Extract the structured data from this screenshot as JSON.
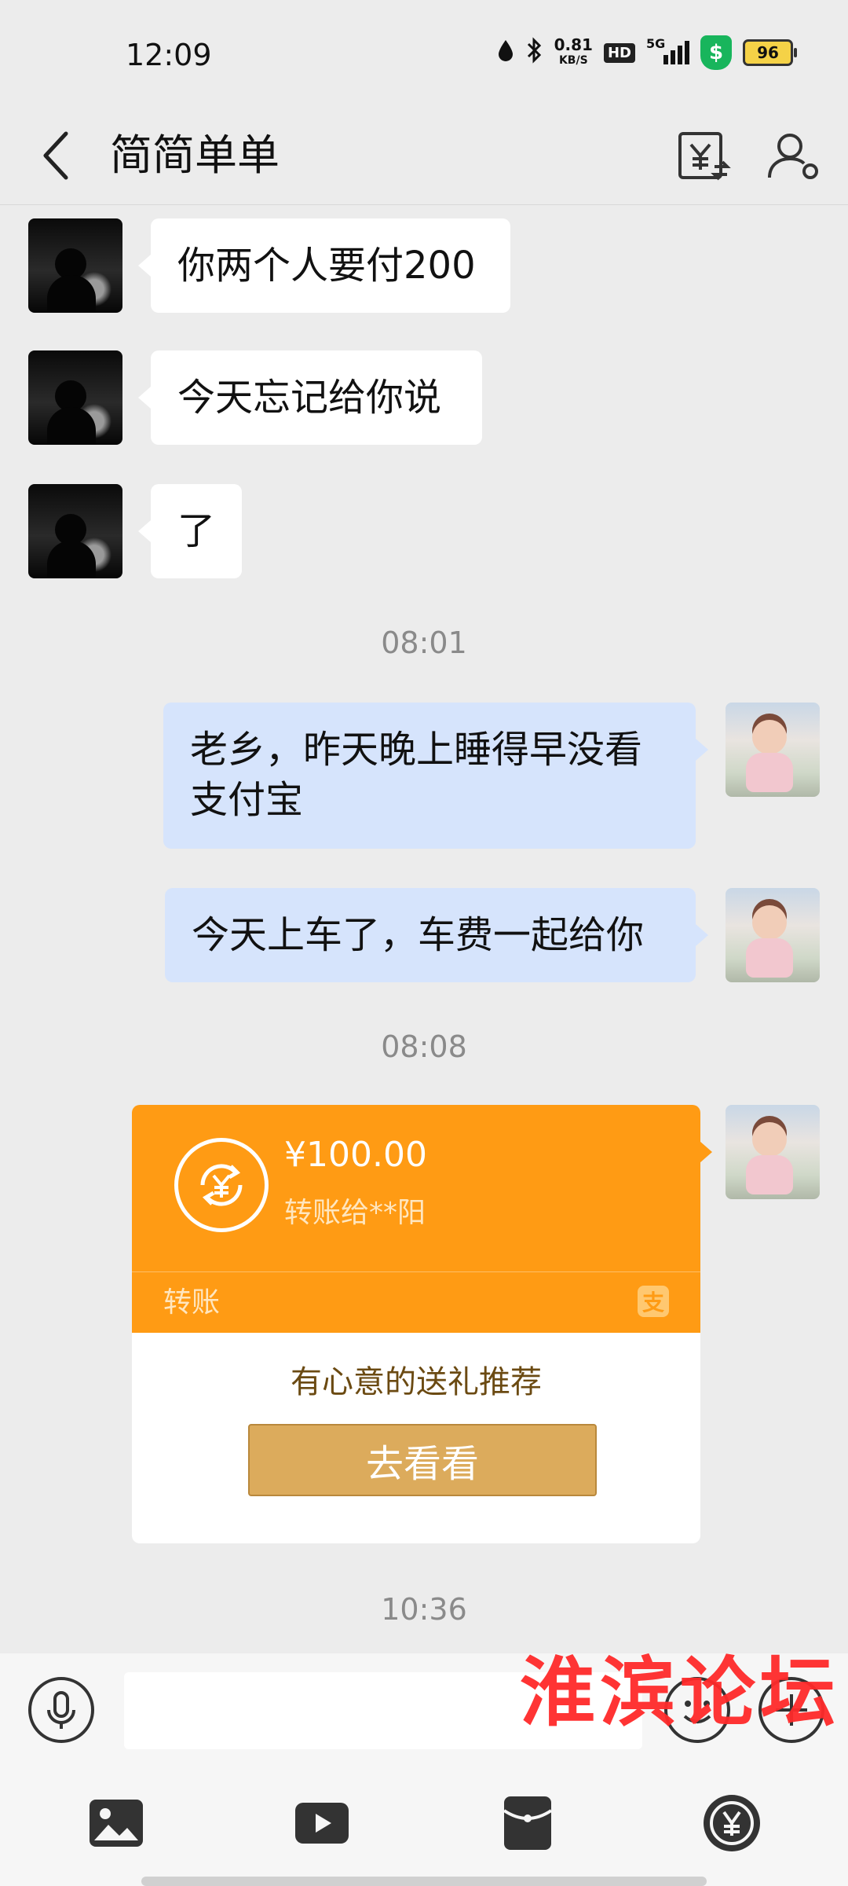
{
  "status_bar": {
    "time": "12:09",
    "net_speed": "0.81",
    "net_unit": "KB/S",
    "hd": "HD",
    "network": "5G",
    "battery": "96"
  },
  "header": {
    "title": "简简单单"
  },
  "messages": [
    {
      "side": "left",
      "text": "你两个人要付200"
    },
    {
      "side": "left",
      "text": "今天忘记给你说"
    },
    {
      "side": "left",
      "text": "了"
    },
    {
      "side": "right",
      "text": "老乡，昨天晚上睡得早没看支付宝"
    },
    {
      "side": "right",
      "text": "今天上车了，车费一起给你"
    }
  ],
  "timestamps": [
    "08:01",
    "08:08",
    "10:36"
  ],
  "transfer_card": {
    "amount": "¥100.00",
    "recipient": "转账给**阳",
    "label": "转账",
    "badge": "支",
    "promo_text": "有心意的送礼推荐",
    "button_label": "去看看"
  },
  "watermark": "淮滨论坛",
  "icons": {
    "back": "back-arrow-icon",
    "header_transfer": "yen-transfer-icon",
    "header_profile": "user-settings-icon",
    "mic": "microphone-icon",
    "emoji": "emoji-icon",
    "plus": "plus-icon",
    "toolbar": [
      "image-icon",
      "video-icon",
      "red-packet-icon",
      "transfer-icon"
    ]
  },
  "colors": {
    "accent_orange": "#ff9b14",
    "right_bubble": "#d6e4fc",
    "button_gold": "#dcab5c"
  }
}
